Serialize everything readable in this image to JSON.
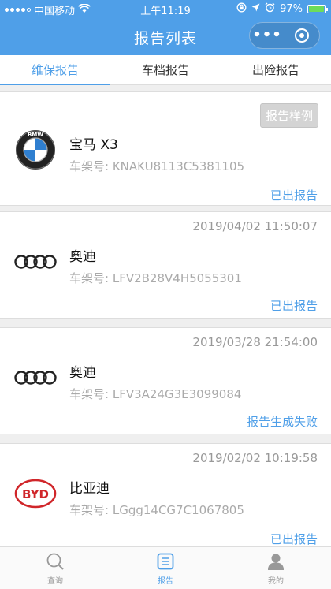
{
  "status_bar": {
    "carrier": "中国移动",
    "time": "上午11:19",
    "battery": "97%"
  },
  "nav": {
    "title": "报告列表",
    "more_glyph": "•••"
  },
  "tabs": [
    {
      "label": "维保报告",
      "active": true
    },
    {
      "label": "车档报告",
      "active": false
    },
    {
      "label": "出险报告",
      "active": false
    }
  ],
  "reports": [
    {
      "sample_label": "报告样例",
      "brand": "宝马 X3",
      "brand_logo": "bmw-logo",
      "logo_text": "BMW",
      "vin_label": "车架号:",
      "vin": "KNAKU8113C5381105",
      "status": "已出报告"
    },
    {
      "date": "2019/04/02 11:50:07",
      "brand": "奥迪",
      "brand_logo": "audi-logo",
      "vin_label": "车架号:",
      "vin": "LFV2B28V4H5055301",
      "status": "已出报告"
    },
    {
      "date": "2019/03/28 21:54:00",
      "brand": "奥迪",
      "brand_logo": "audi-logo",
      "vin_label": "车架号:",
      "vin": "LFV3A24G3E3099084",
      "status": "报告生成失败"
    },
    {
      "date": "2019/02/02 10:19:58",
      "brand": "比亚迪",
      "brand_logo": "byd-logo",
      "logo_text": "BYD",
      "vin_label": "车架号:",
      "vin": "LGgg14CG7C1067805",
      "status": "已出报告"
    }
  ],
  "tabbar": [
    {
      "label": "查询",
      "icon": "search-icon",
      "active": false
    },
    {
      "label": "报告",
      "icon": "report-icon",
      "active": true
    },
    {
      "label": "我的",
      "icon": "profile-icon",
      "active": false
    }
  ],
  "colors": {
    "accent": "#4f9fe8",
    "byd_red": "#d0262a"
  }
}
